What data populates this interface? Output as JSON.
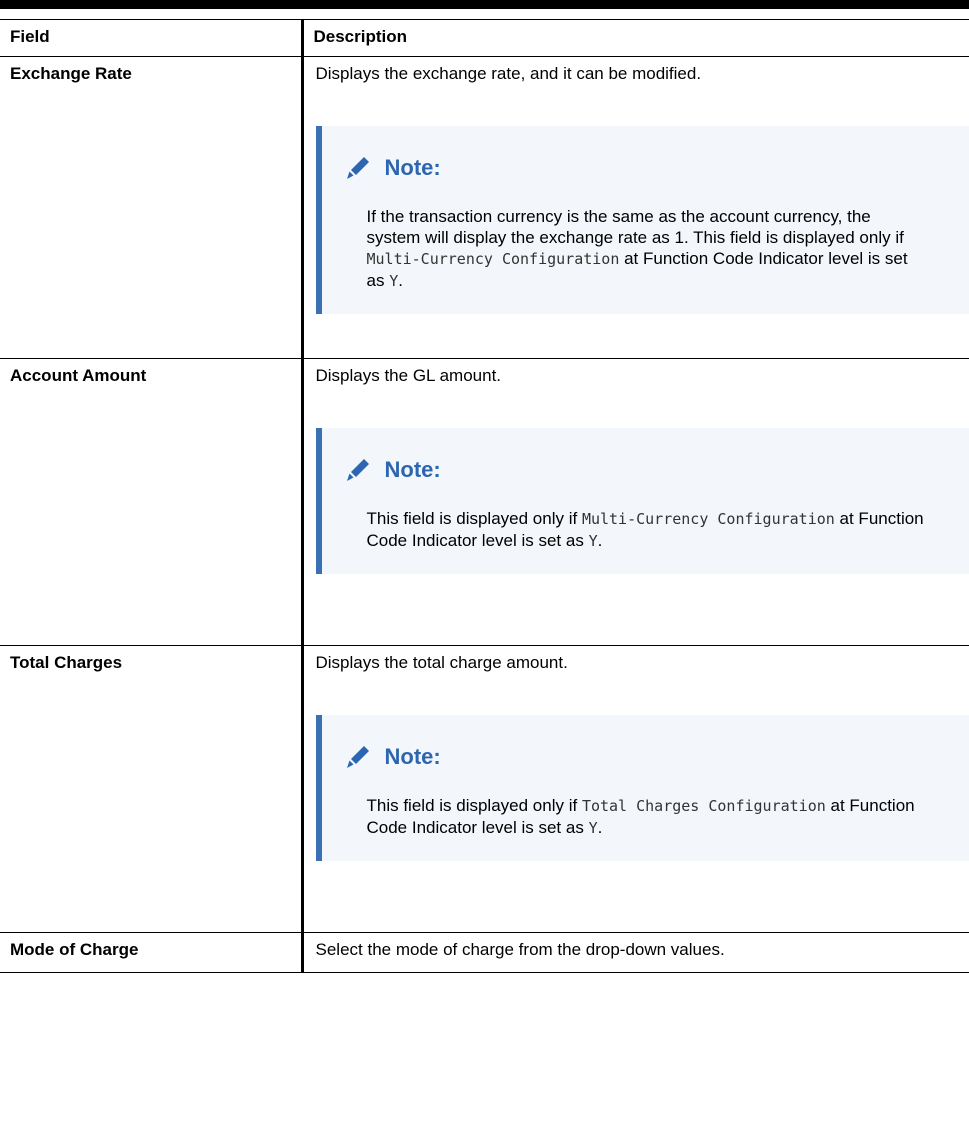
{
  "table": {
    "headers": {
      "field": "Field",
      "description": "Description"
    },
    "rows": [
      {
        "field": "Exchange Rate",
        "description": "Displays the exchange rate, and it can be modified.",
        "note": {
          "title": "Note:",
          "text_1": "If the transaction currency is the same as the account currency, the system will display the exchange rate as 1. This field is displayed only if ",
          "code_1": "Multi-Currency Configuration",
          "text_2": " at Function Code Indicator level is set as ",
          "code_2": "Y",
          "text_3": "."
        }
      },
      {
        "field": "Account Amount",
        "description": "Displays the GL amount.",
        "note": {
          "title": "Note:",
          "text_1": "This field is displayed only if ",
          "code_1": "Multi-Currency Configuration",
          "text_2": " at Function Code Indicator level is set as ",
          "code_2": "Y",
          "text_3": "."
        }
      },
      {
        "field": "Total Charges",
        "description": "Displays the total charge amount.",
        "note": {
          "title": "Note:",
          "text_1": "This field is displayed only if ",
          "code_1": "Total Charges Configuration",
          "text_2": " at Function Code Indicator level is set as ",
          "code_2": "Y",
          "text_3": "."
        }
      },
      {
        "field": "Mode of Charge",
        "description": "Select the mode of charge from the drop-down values."
      }
    ]
  },
  "icons": {
    "note": "pencil-icon"
  },
  "colors": {
    "note_accent": "#3a71b3",
    "note_title": "#2d66b0",
    "note_background": "#f3f6fb"
  }
}
